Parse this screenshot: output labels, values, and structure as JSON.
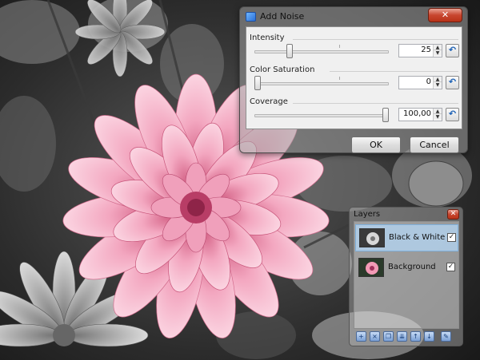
{
  "dialog": {
    "title": "Add Noise",
    "close_glyph": "✕",
    "params": [
      {
        "label": "Intensity",
        "value": "25",
        "fraction": 0.25
      },
      {
        "label": "Color Saturation",
        "value": "0",
        "fraction": 0.0
      },
      {
        "label": "Coverage",
        "value": "100,00",
        "fraction": 1.0
      }
    ],
    "ok_label": "OK",
    "cancel_label": "Cancel",
    "reset_glyph": "↶"
  },
  "layers": {
    "title": "Layers",
    "close_glyph": "✕",
    "items": [
      {
        "name": "Black & White",
        "checked": "✓",
        "selected": true
      },
      {
        "name": "Background",
        "checked": "✓",
        "selected": false
      }
    ],
    "tools": [
      "add-layer-icon",
      "delete-layer-icon",
      "duplicate-layer-icon",
      "merge-layer-icon",
      "move-up-icon",
      "move-down-icon",
      "properties-icon"
    ]
  },
  "colors": {
    "close_red": "#c8462f",
    "dahlia_pink": "#f29ab5",
    "accent_blue": "#1a5fb4"
  }
}
